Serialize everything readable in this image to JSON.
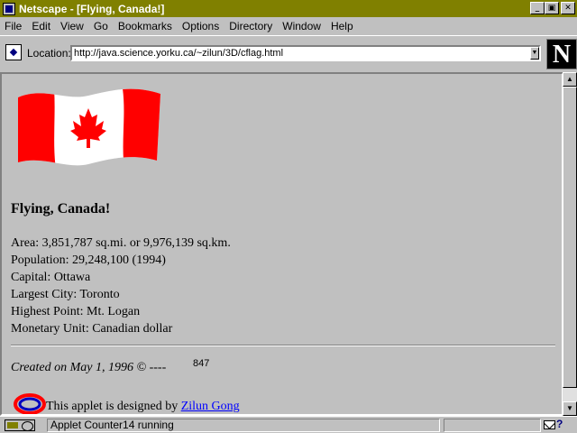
{
  "window": {
    "title": "Netscape - [Flying, Canada!]",
    "minimize_label": "_",
    "restore_label": "▣",
    "close_label": "✕"
  },
  "menu": [
    "File",
    "Edit",
    "View",
    "Go",
    "Bookmarks",
    "Options",
    "Directory",
    "Window",
    "Help"
  ],
  "location": {
    "label": "Location:",
    "url": "http://java.science.yorku.ca/~zilun/3D/cflag.html",
    "dropdown_label": "▼"
  },
  "logo": {
    "letter": "N"
  },
  "page": {
    "heading": "Flying, Canada!",
    "facts": [
      "Area: 3,851,787 sq.mi. or 9,976,139 sq.km.",
      "Population: 29,248,100 (1994)",
      "Capital: Ottawa",
      "Largest City: Toronto",
      "Highest Point: Mt. Logan",
      "Monetary Unit: Canadian dollar"
    ],
    "created": "Created on May 1, 1996 © ----",
    "counter": "847",
    "applet_text": "This applet is designed by ",
    "author": "Zilun Gong"
  },
  "scrollbar": {
    "up_label": "▲",
    "down_label": "▼"
  },
  "status": {
    "text": "Applet Counter14 running",
    "mail_label": "?"
  },
  "colors": {
    "titlebar": "#808000",
    "background": "#c0c0c0",
    "link": "#0000ff",
    "flag_red": "#ff0000"
  },
  "icons": [
    "app-icon",
    "bookmark-icon",
    "netscape-logo-icon",
    "canada-flag-image",
    "applet-logo-icon",
    "security-key-icon",
    "mail-icon"
  ]
}
